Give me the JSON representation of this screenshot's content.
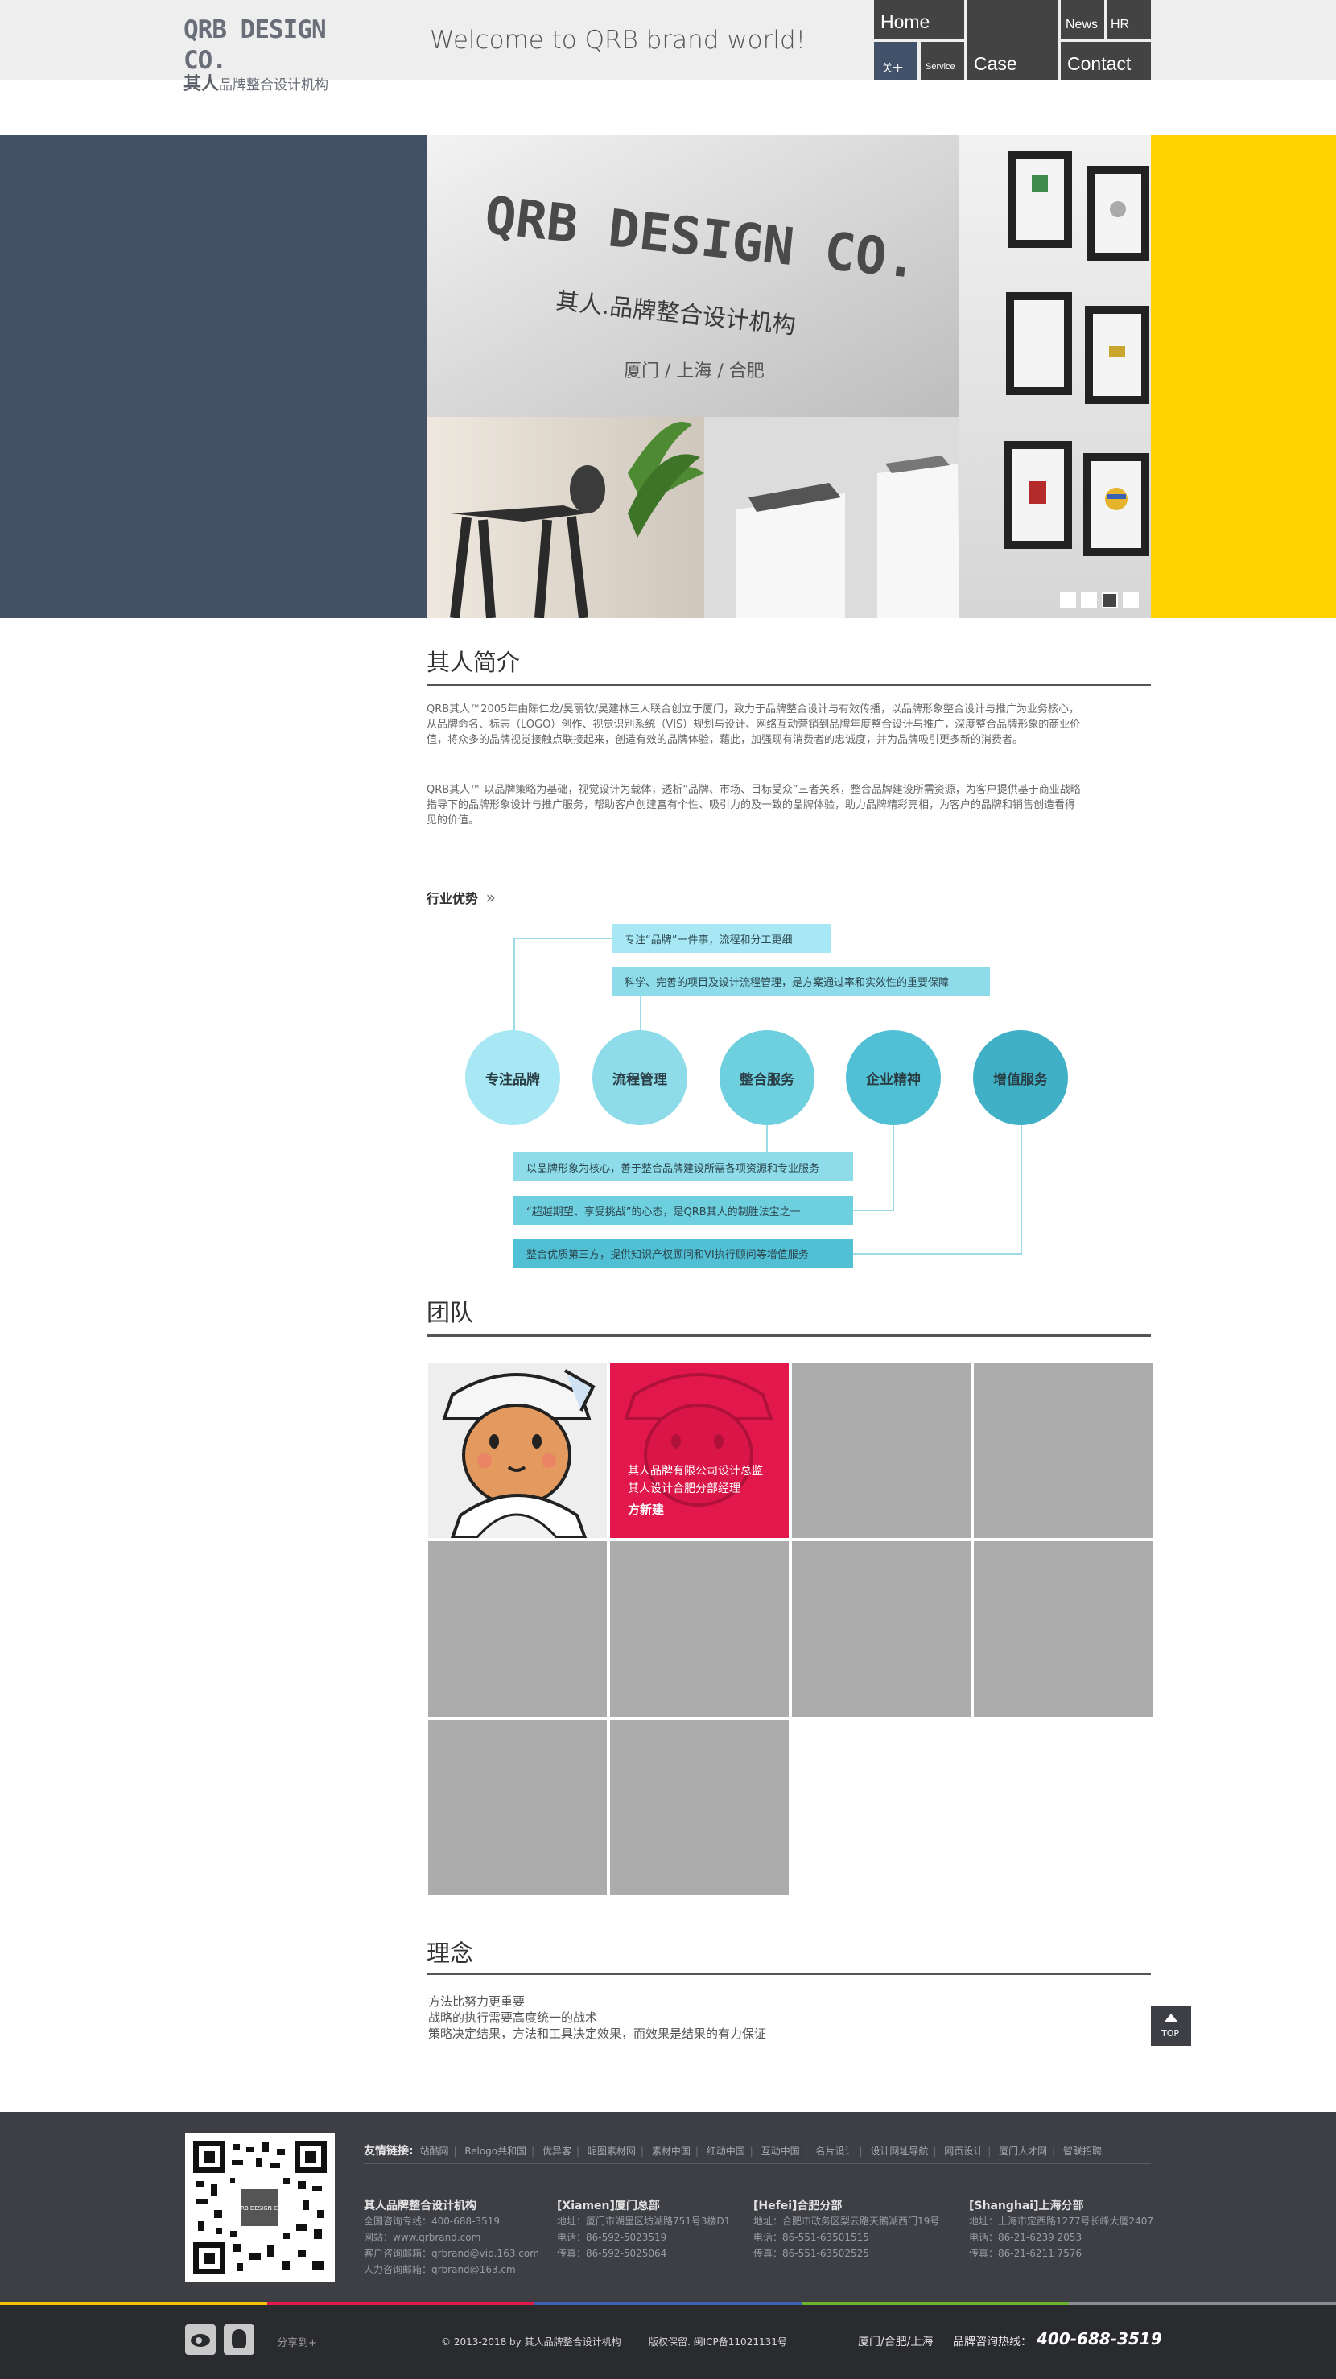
{
  "header": {
    "logo_en": "QRB DESIGN CO.",
    "logo_cn_mark": "其人",
    "logo_cn_text": "品牌整合设计机构",
    "welcome": "Welcome to QRB brand world!"
  },
  "nav": {
    "home": "Home",
    "news": "News",
    "hr": "HR",
    "about": "关于",
    "service": "Service",
    "case": "Case",
    "contact": "Contact"
  },
  "hero": {
    "wall_logo": "QRB DESIGN CO.",
    "wall_cn": "其人.品牌整合设计机构",
    "wall_cities": "厦门 / 上海 / 合肥",
    "slide_count": 4,
    "active_slide": 3,
    "colors": {
      "left": "#435066",
      "right": "#ffd200"
    }
  },
  "intro": {
    "title": "其人简介",
    "p1": "QRB其人™2005年由陈仁龙/吴丽钦/吴建林三人联合创立于厦门，致力于品牌整合设计与有效传播，以品牌形象整合设计与推广为业务核心，从品牌命名、标志（LOGO）创作、视觉识别系统（VIS）规划与设计、网络互动营销到品牌年度整合设计与推广，深度整合品牌形象的商业价值，将众多的品牌视觉接触点联接起来，创造有效的品牌体验，藉此，加强现有消费者的忠诚度，并为品牌吸引更多新的消费者。",
    "p2": "QRB其人™ 以品牌策略为基础，视觉设计为载体，透析“品牌、市场、目标受众”三者关系，整合品牌建设所需资源，为客户提供基于商业战略指导下的品牌形象设计与推广服务，帮助客户创建富有个性、吸引力的及一致的品牌体验，助力品牌精彩亮相，为客户的品牌和销售创造看得见的价值。"
  },
  "advantages": {
    "title": "行业优势",
    "chevrons": "»",
    "top_boxes": [
      "专注“品牌”一件事，流程和分工更细",
      "科学、完善的项目及设计流程管理，是方案通过率和实效性的重要保障"
    ],
    "circles": [
      "专注品牌",
      "流程管理",
      "整合服务",
      "企业精神",
      "增值服务"
    ],
    "bottom_boxes": [
      "以品牌形象为核心，善于整合品牌建设所需各项资源和专业服务",
      "“超越期望、享受挑战”的心态，是QRB其人的制胜法宝之一",
      "整合优质第三方，提供知识产权顾问和VI执行顾问等增值服务"
    ],
    "circle_colors": [
      "#a8e8f4",
      "#8edbe9",
      "#6ecfdf",
      "#52c0d4",
      "#3fb0c6"
    ]
  },
  "team": {
    "title": "团队",
    "member_role_1": "其人品牌有限公司设计总监",
    "member_role_2": "其人设计合肥分部经理",
    "member_name": "方新建",
    "highlight_color": "#e2174b"
  },
  "philosophy": {
    "title": "理念",
    "lines": [
      "方法比努力更重要",
      "战略的执行需要高度统一的战术",
      "策略决定结果，方法和工具决定效果，而效果是结果的有力保证"
    ]
  },
  "top_button": {
    "label": "TOP"
  },
  "footer": {
    "links_label": "友情链接:",
    "links": [
      "站酷网",
      "Relogo共和国",
      "优异客",
      "昵图素材网",
      "素材中国",
      "红动中国",
      "互动中国",
      "名片设计",
      "设计网址导航",
      "网页设计",
      "厦门人才网",
      "智联招聘"
    ],
    "company": {
      "title": "其人品牌整合设计机构",
      "lines": [
        "全国咨询专线：400-688-3519",
        "网站：www.qrbrand.com",
        "客户咨询邮箱：qrbrand@vip.163.com",
        "人力咨询邮箱：qrbrand@163.cm"
      ]
    },
    "xiamen": {
      "title": "[Xiamen]厦门总部",
      "lines": [
        "地址：厦门市湖里区坊湖路751号3楼D1",
        "电话：86-592-5023519",
        "传真：86-592-5025064"
      ]
    },
    "hefei": {
      "title": "[Hefei]合肥分部",
      "lines": [
        "地址：合肥市政务区梨云路天鹅湖西门19号",
        "电话：86-551-63501515",
        "传真：86-551-63502525"
      ]
    },
    "shanghai": {
      "title": "[Shanghai]上海分部",
      "lines": [
        "地址：上海市定西路1277号长峰大厦2407",
        "电话：86-21-6239 2053",
        "传真：86-21-6211 7576"
      ]
    },
    "qr_label": "QRB DESIGN CO."
  },
  "bottom": {
    "share": "分享到+",
    "copyright": "© 2013-2018 by 其人品牌整合设计机构",
    "rights": "版权保留. 闽ICP备11021131号",
    "cities": "厦门/合肥/上海",
    "hotline_label": "品牌咨询热线：",
    "hotline": "400-688-3519"
  }
}
